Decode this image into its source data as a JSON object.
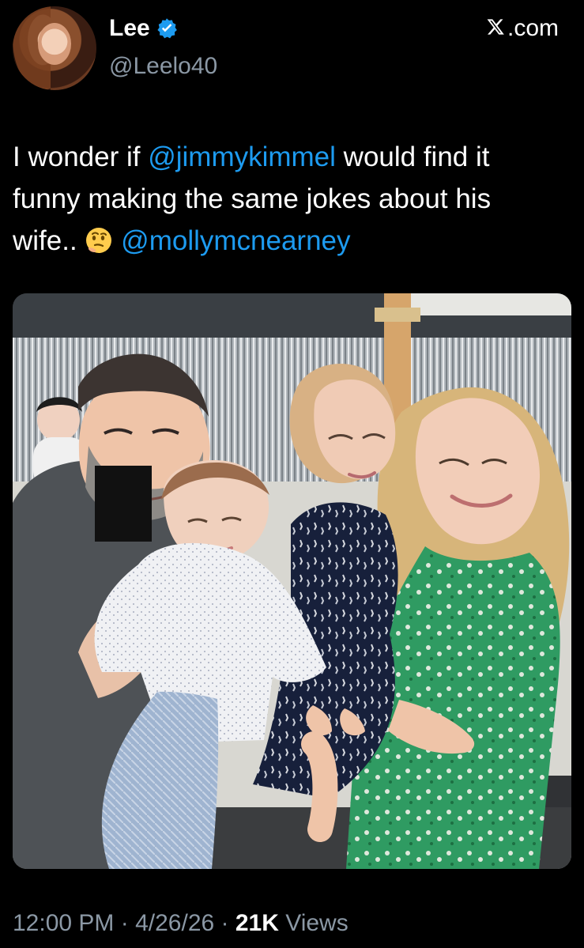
{
  "header": {
    "display_name": "Lee",
    "handle": "@Leelo40",
    "source_label": ".com",
    "icons": {
      "avatar": "profile-photo",
      "verified": "verified-badge-icon",
      "brand": "x-logo-icon"
    }
  },
  "tweet": {
    "text_1": "I wonder if ",
    "mention_1": "@jimmykimmel",
    "text_2": " would find it funny making the same jokes about his wife..",
    "emoji": "thinking-face-emoji",
    "mention_2": "@mollymcnearney"
  },
  "meta": {
    "time": "12:00 PM",
    "separator_1": " · ",
    "date": "4/26/26",
    "separator_2": " · ",
    "views_count": "21K",
    "views_label": " Views"
  },
  "colors": {
    "background": "#000000",
    "text": "#ffffff",
    "muted": "#8b98a5",
    "accent": "#1d9bf0"
  }
}
